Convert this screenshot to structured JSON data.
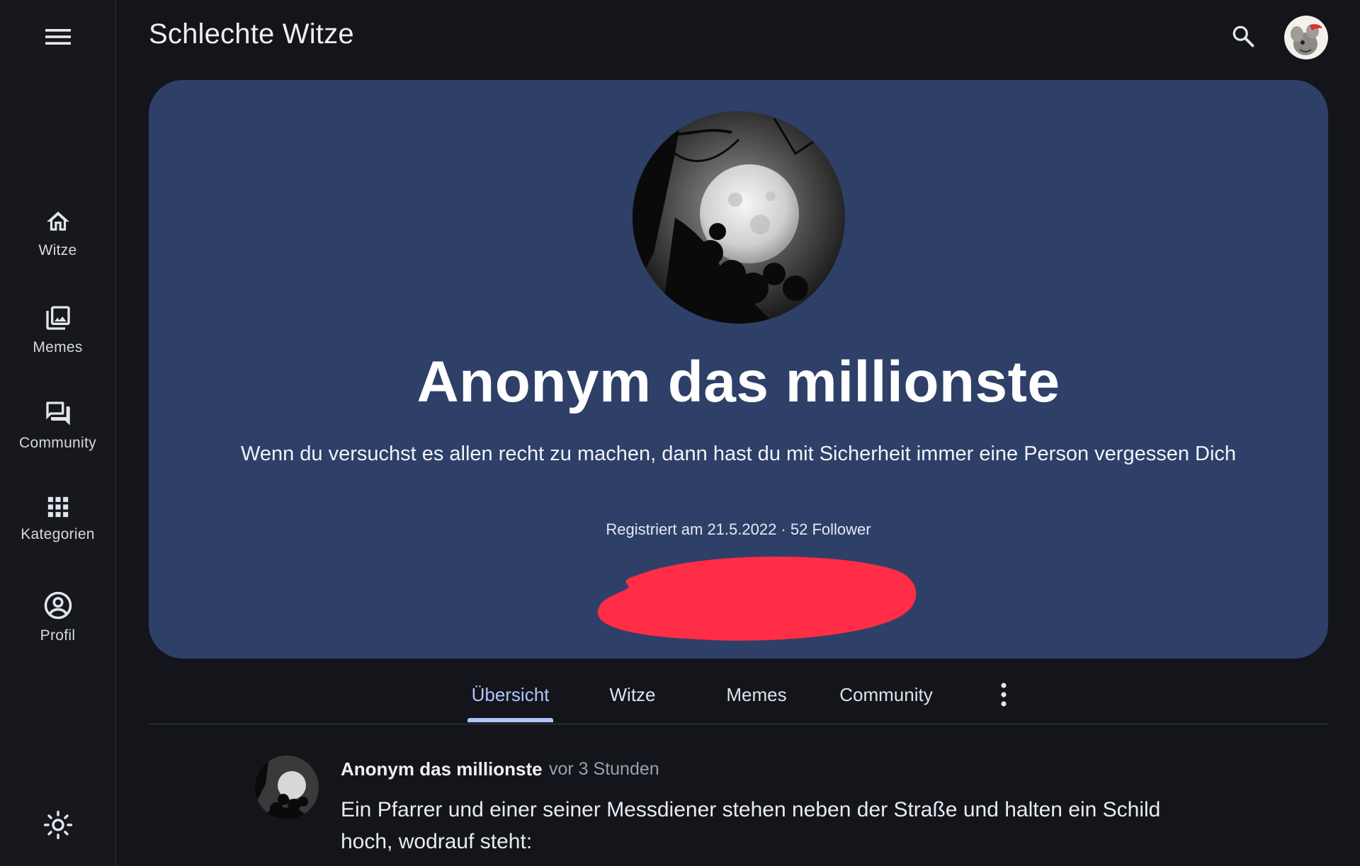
{
  "app": {
    "title": "Schlechte Witze"
  },
  "sidebar": {
    "menu_icon": "menu-icon",
    "items": [
      {
        "label": "Witze",
        "icon": "home-icon"
      },
      {
        "label": "Memes",
        "icon": "image-stack-icon"
      },
      {
        "label": "Community",
        "icon": "forum-icon"
      },
      {
        "label": "Kategorien",
        "icon": "grid-icon"
      },
      {
        "label": "Profil",
        "icon": "account-circle-icon"
      }
    ],
    "theme_icon": "sun-icon"
  },
  "header": {
    "search_icon": "search-icon",
    "avatar": "user-avatar"
  },
  "profile": {
    "name": "Anonym das millionste",
    "bio": "Wenn du versuchst es allen recht zu machen, dann hast du mit Sicherheit immer eine Person vergessen Dich",
    "meta": "Registriert am 21.5.2022 · 52 Follower",
    "avatar": "moon-avatar"
  },
  "tabs": [
    {
      "label": "Übersicht",
      "active": true
    },
    {
      "label": "Witze",
      "active": false
    },
    {
      "label": "Memes",
      "active": false
    },
    {
      "label": "Community",
      "active": false
    }
  ],
  "post": {
    "author": "Anonym das millionste",
    "time": "vor 3 Stunden",
    "body": "Ein Pfarrer und einer seiner Messdiener stehen neben der Straße und halten ein Schild hoch, wodrauf steht:"
  },
  "colors": {
    "background": "#14151b",
    "card": "#2e4068",
    "accent": "#aec6ff",
    "redaction": "#ff2d45"
  }
}
